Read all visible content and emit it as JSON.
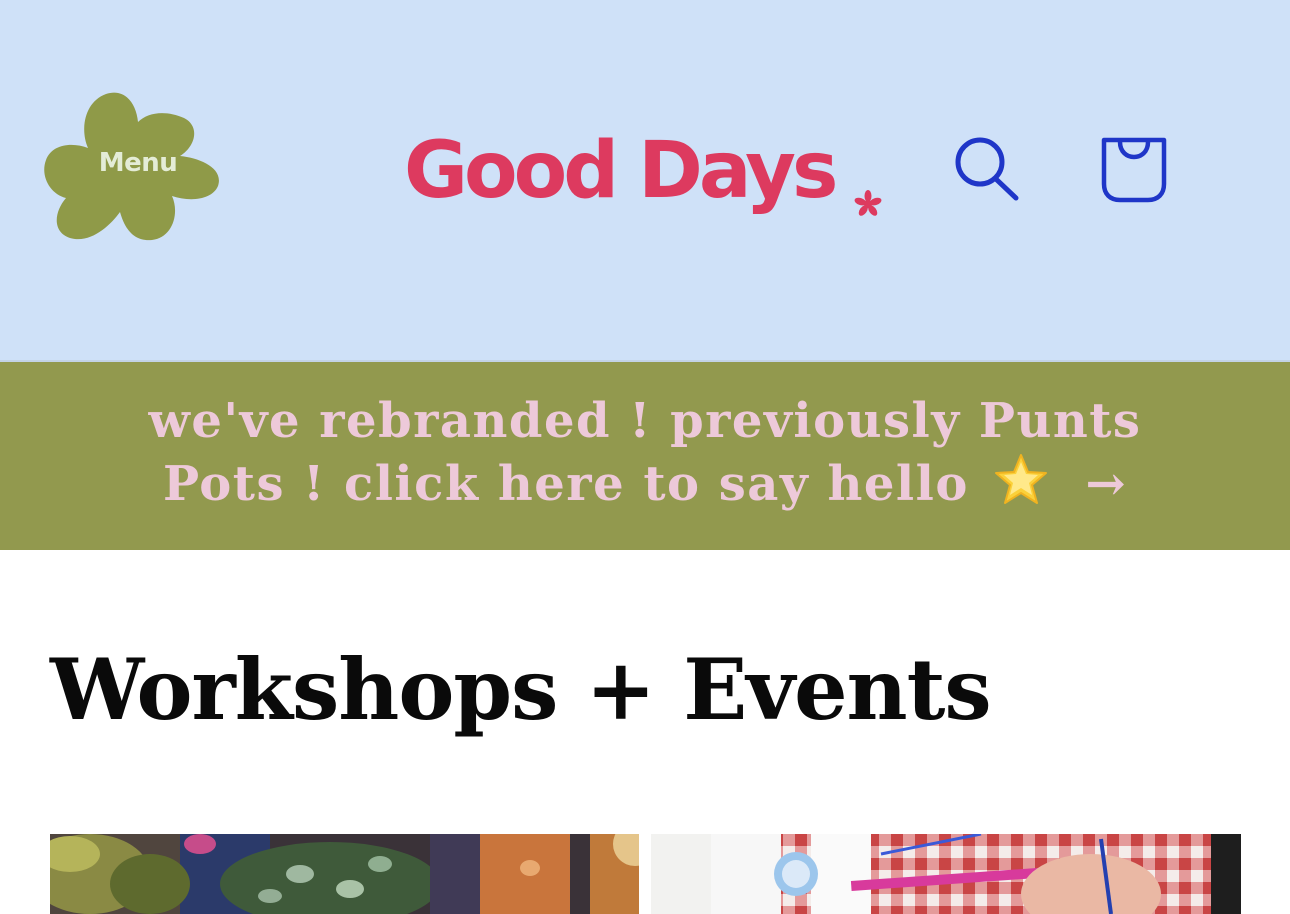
{
  "header": {
    "menu_label": "Menu",
    "logo_text": "Good Days",
    "background_color": "#cfe1f8",
    "logo_color": "#dd3a5f",
    "menu_blob_color": "#8f9a48",
    "icon_color": "#1f36c8",
    "icons": {
      "search": "search-icon",
      "cart": "bag-icon",
      "logo_star": "asterisk-star-icon"
    }
  },
  "banner": {
    "text_main": "we've rebranded ! previously Punts Pots ! click here to say hello",
    "emoji": "star-emoji",
    "arrow": "→",
    "background_color": "#92994e",
    "text_color": "#edc9d9"
  },
  "main": {
    "title": "Workshops + Events",
    "cards": [
      {
        "image": "plants-workshop-photo"
      },
      {
        "image": "painting-workshop-photo"
      }
    ]
  }
}
